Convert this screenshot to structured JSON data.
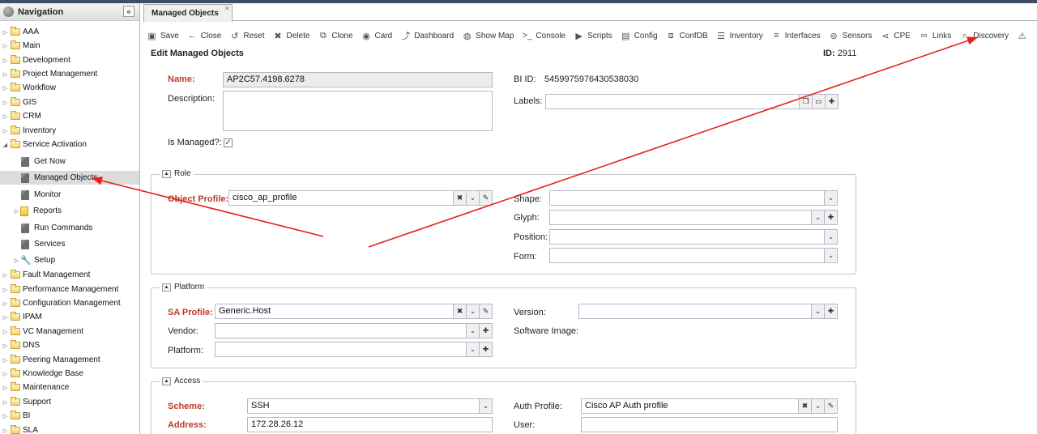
{
  "sidebar": {
    "title": "Navigation",
    "collapse_glyph": "«",
    "items": [
      {
        "label": "AAA",
        "type": "folder"
      },
      {
        "label": "Main",
        "type": "folder"
      },
      {
        "label": "Development",
        "type": "folder"
      },
      {
        "label": "Project Management",
        "type": "folder"
      },
      {
        "label": "Workflow",
        "type": "folder"
      },
      {
        "label": "GIS",
        "type": "folder"
      },
      {
        "label": "CRM",
        "type": "folder"
      },
      {
        "label": "Inventory",
        "type": "folder"
      },
      {
        "label": "Service Activation",
        "type": "folder",
        "expanded": true
      },
      {
        "label": "Get Now",
        "type": "leaf"
      },
      {
        "label": "Managed Objects",
        "type": "leaf",
        "selected": true
      },
      {
        "label": "Monitor",
        "type": "leaf"
      },
      {
        "label": "Reports",
        "type": "leaf-yellow"
      },
      {
        "label": "Run Commands",
        "type": "leaf"
      },
      {
        "label": "Services",
        "type": "leaf"
      },
      {
        "label": "Setup",
        "type": "wrench"
      },
      {
        "label": "Fault Management",
        "type": "folder"
      },
      {
        "label": "Performance Management",
        "type": "folder"
      },
      {
        "label": "Configuration Management",
        "type": "folder"
      },
      {
        "label": "IPAM",
        "type": "folder"
      },
      {
        "label": "VC Management",
        "type": "folder"
      },
      {
        "label": "DNS",
        "type": "folder"
      },
      {
        "label": "Peering Management",
        "type": "folder"
      },
      {
        "label": "Knowledge Base",
        "type": "folder"
      },
      {
        "label": "Maintenance",
        "type": "folder"
      },
      {
        "label": "Support",
        "type": "folder"
      },
      {
        "label": "BI",
        "type": "folder"
      },
      {
        "label": "SLA",
        "type": "folder"
      }
    ]
  },
  "tab": {
    "label": "Managed Objects",
    "close": "×"
  },
  "toolbar": [
    {
      "label": "Save",
      "icon": "save-icon",
      "glyph": "▣"
    },
    {
      "label": "Close",
      "icon": "back-arrow-icon",
      "glyph": "←"
    },
    {
      "label": "Reset",
      "icon": "reset-icon",
      "glyph": "↺"
    },
    {
      "label": "Delete",
      "icon": "delete-icon",
      "glyph": "✖"
    },
    {
      "label": "Clone",
      "icon": "clone-icon",
      "glyph": "⧉"
    },
    {
      "label": "Card",
      "icon": "eye-icon",
      "glyph": "◉"
    },
    {
      "label": "Dashboard",
      "icon": "chart-icon",
      "glyph": "⤴"
    },
    {
      "label": "Show Map",
      "icon": "globe-icon",
      "glyph": "◍"
    },
    {
      "label": "Console",
      "icon": "terminal-icon",
      "glyph": ">_"
    },
    {
      "label": "Scripts",
      "icon": "play-icon",
      "glyph": "▶"
    },
    {
      "label": "Config",
      "icon": "file-icon",
      "glyph": "▤"
    },
    {
      "label": "ConfDB",
      "icon": "database-icon",
      "glyph": "⧈"
    },
    {
      "label": "Inventory",
      "icon": "list-icon",
      "glyph": "☰"
    },
    {
      "label": "Interfaces",
      "icon": "interfaces-icon",
      "glyph": "≡"
    },
    {
      "label": "Sensors",
      "icon": "sensor-icon",
      "glyph": "⊚"
    },
    {
      "label": "CPE",
      "icon": "share-icon",
      "glyph": "⋖"
    },
    {
      "label": "Links",
      "icon": "link-icon",
      "glyph": "∞"
    },
    {
      "label": "Discovery",
      "icon": "search-icon",
      "glyph": "⌕"
    },
    {
      "label": "",
      "icon": "warning-icon",
      "glyph": "⚠"
    }
  ],
  "form": {
    "title": "Edit Managed Objects",
    "id_label": "ID:",
    "id_value": "2911",
    "name_label": "Name:",
    "name_value": "AP2C57.4198.6278",
    "description_label": "Description:",
    "description_value": "",
    "bi_id_label": "BI ID:",
    "bi_id_value": "5459975976430538030",
    "labels_label": "Labels:",
    "labels_value": "",
    "is_managed_label": "Is Managed?:",
    "is_managed_checked": "✓"
  },
  "role": {
    "legend": "Role",
    "object_profile_label": "Object Profile:",
    "object_profile_value": "cisco_ap_profile",
    "shape_label": "Shape:",
    "shape_value": "",
    "glyph_label": "Glyph:",
    "glyph_value": "",
    "position_label": "Position:",
    "position_value": "",
    "form_label": "Form:",
    "form_value": ""
  },
  "platform": {
    "legend": "Platform",
    "sa_profile_label": "SA Profile:",
    "sa_profile_value": "Generic.Host",
    "vendor_label": "Vendor:",
    "vendor_value": "",
    "platform_label": "Platform:",
    "platform_value": "",
    "version_label": "Version:",
    "version_value": "",
    "software_image_label": "Software Image:"
  },
  "access": {
    "legend": "Access",
    "scheme_label": "Scheme:",
    "scheme_value": "SSH",
    "address_label": "Address:",
    "address_value": "172.28.26.12",
    "auth_profile_label": "Auth Profile:",
    "auth_profile_value": "Cisco AP Auth profile",
    "user_label": "User:",
    "user_value": ""
  },
  "colors": {
    "annotation": "#e8201e",
    "required": "#c0392b",
    "accent": "#3f4e66"
  }
}
